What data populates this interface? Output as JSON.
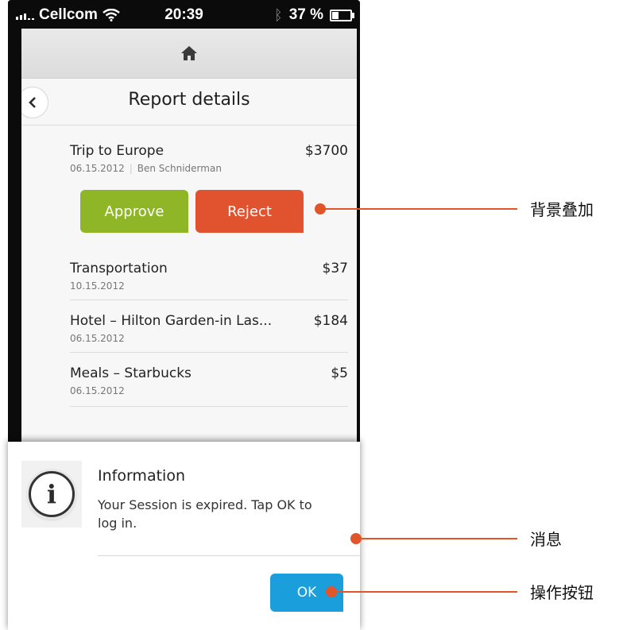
{
  "status_bar": {
    "carrier": "Cellcom",
    "time": "20:39",
    "battery": "37 %",
    "icons": [
      "signal-icon",
      "wifi-icon",
      "bluetooth-icon",
      "battery-icon"
    ]
  },
  "nav": {
    "home_icon": "home-icon",
    "back_icon": "chevron-left-icon",
    "title": "Report details"
  },
  "report": {
    "name": "Trip to Europe",
    "amount": "$3700",
    "date": "06.15.2012",
    "author": "Ben Schniderman",
    "approve_label": "Approve",
    "reject_label": "Reject"
  },
  "items": [
    {
      "name": "Transportation",
      "amount": "$37",
      "date": "10.15.2012"
    },
    {
      "name": "Hotel – Hilton Garden-in Las...",
      "amount": "$184",
      "date": "06.15.2012"
    },
    {
      "name": "Meals – Starbucks",
      "amount": "$5",
      "date": "06.15.2012"
    }
  ],
  "dialog": {
    "icon": "info-icon",
    "title": "Information",
    "message": "Your Session is expired. Tap OK to log in.",
    "ok_label": "OK"
  },
  "annotations": [
    {
      "label": "背景叠加"
    },
    {
      "label": "消息"
    },
    {
      "label": "操作按钮"
    }
  ],
  "colors": {
    "approve": "#8fb626",
    "reject": "#e1522e",
    "ok": "#1a9fdc",
    "annotation": "#e0552a"
  }
}
